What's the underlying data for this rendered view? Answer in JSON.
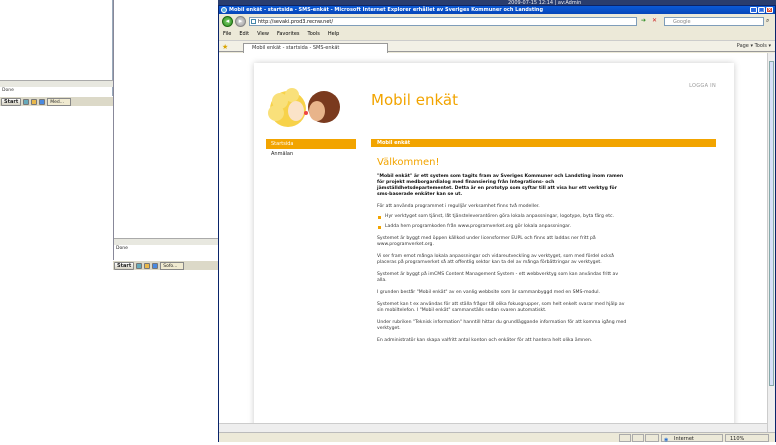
{
  "bg_window_1": {
    "status": "Done",
    "taskbar": {
      "start": "Start",
      "task": "Med..."
    }
  },
  "bg_window_2": {
    "status": "Done",
    "taskbar": {
      "start": "Start",
      "task": "Sofo..."
    }
  },
  "top_strip": {
    "text": "2009-07-15 12:14 | av:Admin"
  },
  "ie": {
    "title": "Mobil enkät - startsida - SMS-enkät - Microsoft Internet Explorer erhållet av Sveriges Kommuner och Landsting",
    "address": "http://sevaki.prod3.recnw.net/",
    "search_placeholder": "Google",
    "menu": [
      "File",
      "Edit",
      "View",
      "Favorites",
      "Tools",
      "Help"
    ],
    "tab_label": "Mobil enkät - startsida - SMS-enkät",
    "command_bar": "Page ▾ Tools ▾",
    "status_zone": "Internet",
    "zoom": "110%"
  },
  "page": {
    "site_title": "Mobil enkät",
    "login": "LOGGA IN",
    "nav": [
      "Startsida",
      "Anmälan"
    ],
    "section_bar": "Mobil enkät",
    "welcome": "Välkommen!",
    "intro": "\"Mobil enkät\" är ett system som tagits fram av Sveriges Kommuner och Landsting inom ramen för projekt medborgardialog med finansiering från Integrations- och jämställdhetsdepartementet. Detta är en prototyp som syftar till att visa hur ett verktyg för sms-baserade enkäter kan se ut.",
    "p1": "För att använda programmet i regulljär verksamhet finns två modeller.",
    "bullets": [
      "Hyr verktyget som tjänst, låt tjänsteleverantören göra lokala anpassningar, logotype, byta färg etc.",
      "Ladda hem programkoden från www.programverket.org gör lokala anpassningar."
    ],
    "p2": "Systemet är byggt med öppen källkod under licensformer EUPL och finns att laddas ner fritt på www.programverket.org.",
    "p3": "Vi ser fram emot många lokala anpassningar och vidareutveckling av verktyget, som med fördel också placeras på programverket så att offentlig sektor kan ta del av många förbättringar av verktyget.",
    "p4": "Systemet är byggt på imCMS Content Management System - ett webbverktyg som kan användas fritt av alla.",
    "p5": "I grunden består \"Mobil enkät\" av en vanlig webbsite som är sammanbyggd med en SMS-modul.",
    "p6": "Systemet kan t ex användas för att ställa frågor till olika fokusgrupper, som helt enkelt svarar med hjälp av sin mobiltelefon. I \"Mobil enkät\" sammanställs sedan svaren automatiskt.",
    "p7": "Under rubriken \"Teknisk information\" hanntill hittar du grundläggande information för att komma igång med verktyget.",
    "p8": "En administratör kan skapa valfritt antal konton och enkäter för att hantera helt olika ämnen."
  }
}
